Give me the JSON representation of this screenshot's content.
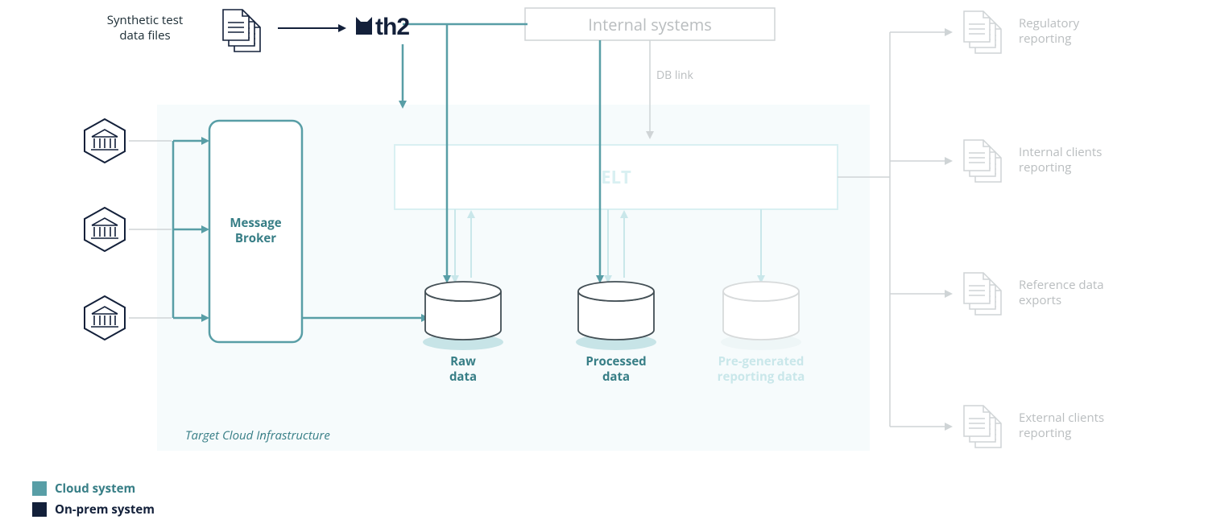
{
  "colors": {
    "teal": "#589ea6",
    "tealDark": "#377e86",
    "navy": "#13203a",
    "faded": "#cfd4d6",
    "fadedText": "#b9bdbf",
    "cloudBg": "#f6fbfc"
  },
  "labels": {
    "synthetic": "Synthetic test\ndata files",
    "internalSystems": "Internal systems",
    "dbLink": "DB link",
    "elt": "ELT",
    "messageBroker": "Message\nBroker",
    "raw": "Raw\ndata",
    "processed": "Processed\ndata",
    "pregen": "Pre-generated\nreporting data",
    "targetCloud": "Target Cloud Infrastructure",
    "reports": {
      "regulatory": "Regulatory\nreporting",
      "internalClients": "Internal clients\nreporting",
      "referenceData": "Reference data\nexports",
      "externalClients": "External clients\nreporting"
    },
    "legend": {
      "cloud": "Cloud system",
      "onprem": "On-prem system"
    },
    "logo": "th2"
  }
}
